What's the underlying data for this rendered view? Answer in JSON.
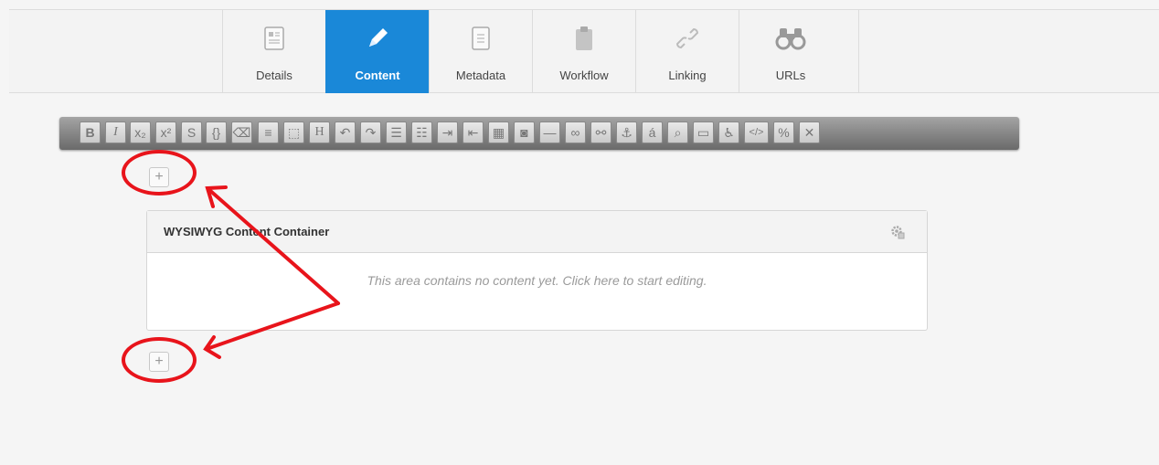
{
  "tabs": [
    {
      "label": "Details",
      "icon": "details-icon",
      "active": false
    },
    {
      "label": "Content",
      "icon": "pencil-icon",
      "active": true
    },
    {
      "label": "Metadata",
      "icon": "metadata-icon",
      "active": false
    },
    {
      "label": "Workflow",
      "icon": "clipboard-icon",
      "active": false
    },
    {
      "label": "Linking",
      "icon": "link-icon",
      "active": false
    },
    {
      "label": "URLs",
      "icon": "binoculars-icon",
      "active": false
    }
  ],
  "toolbar": {
    "buttons": [
      {
        "name": "bold",
        "glyph": "B"
      },
      {
        "name": "italic",
        "glyph": "I"
      },
      {
        "name": "subscript",
        "glyph": "x₂"
      },
      {
        "name": "superscript",
        "glyph": "x²"
      },
      {
        "name": "strikethrough",
        "glyph": "S"
      },
      {
        "name": "code-braces",
        "glyph": "{}"
      },
      {
        "name": "clear-formatting",
        "glyph": "⌫"
      },
      {
        "name": "align",
        "glyph": "≡"
      },
      {
        "name": "block",
        "glyph": "⬚"
      },
      {
        "name": "heading",
        "glyph": "H"
      },
      {
        "name": "undo",
        "glyph": "↶"
      },
      {
        "name": "redo",
        "glyph": "↷"
      },
      {
        "name": "bullet-list",
        "glyph": "☰"
      },
      {
        "name": "numbered-list",
        "glyph": "☷"
      },
      {
        "name": "indent",
        "glyph": "⇥"
      },
      {
        "name": "outdent",
        "glyph": "⇤"
      },
      {
        "name": "table",
        "glyph": "▦"
      },
      {
        "name": "image",
        "glyph": "◙"
      },
      {
        "name": "horizontal-rule",
        "glyph": "—"
      },
      {
        "name": "link",
        "glyph": "∞"
      },
      {
        "name": "unlink",
        "glyph": "⚯"
      },
      {
        "name": "anchor",
        "glyph": "⚓"
      },
      {
        "name": "special-character",
        "glyph": "á"
      },
      {
        "name": "find",
        "glyph": "⌕"
      },
      {
        "name": "comment",
        "glyph": "▭"
      },
      {
        "name": "accessibility",
        "glyph": "♿"
      },
      {
        "name": "source-code",
        "glyph": "</>"
      },
      {
        "name": "percent",
        "glyph": "%"
      },
      {
        "name": "remove-percent",
        "glyph": "✕"
      }
    ]
  },
  "container": {
    "title": "WYSIWYG Content Container",
    "empty_text": "This area contains no content yet. Click here to start editing."
  },
  "add_button": {
    "glyph": "+"
  },
  "colors": {
    "accent": "#1a88d8",
    "annotation": "#e8141b"
  }
}
